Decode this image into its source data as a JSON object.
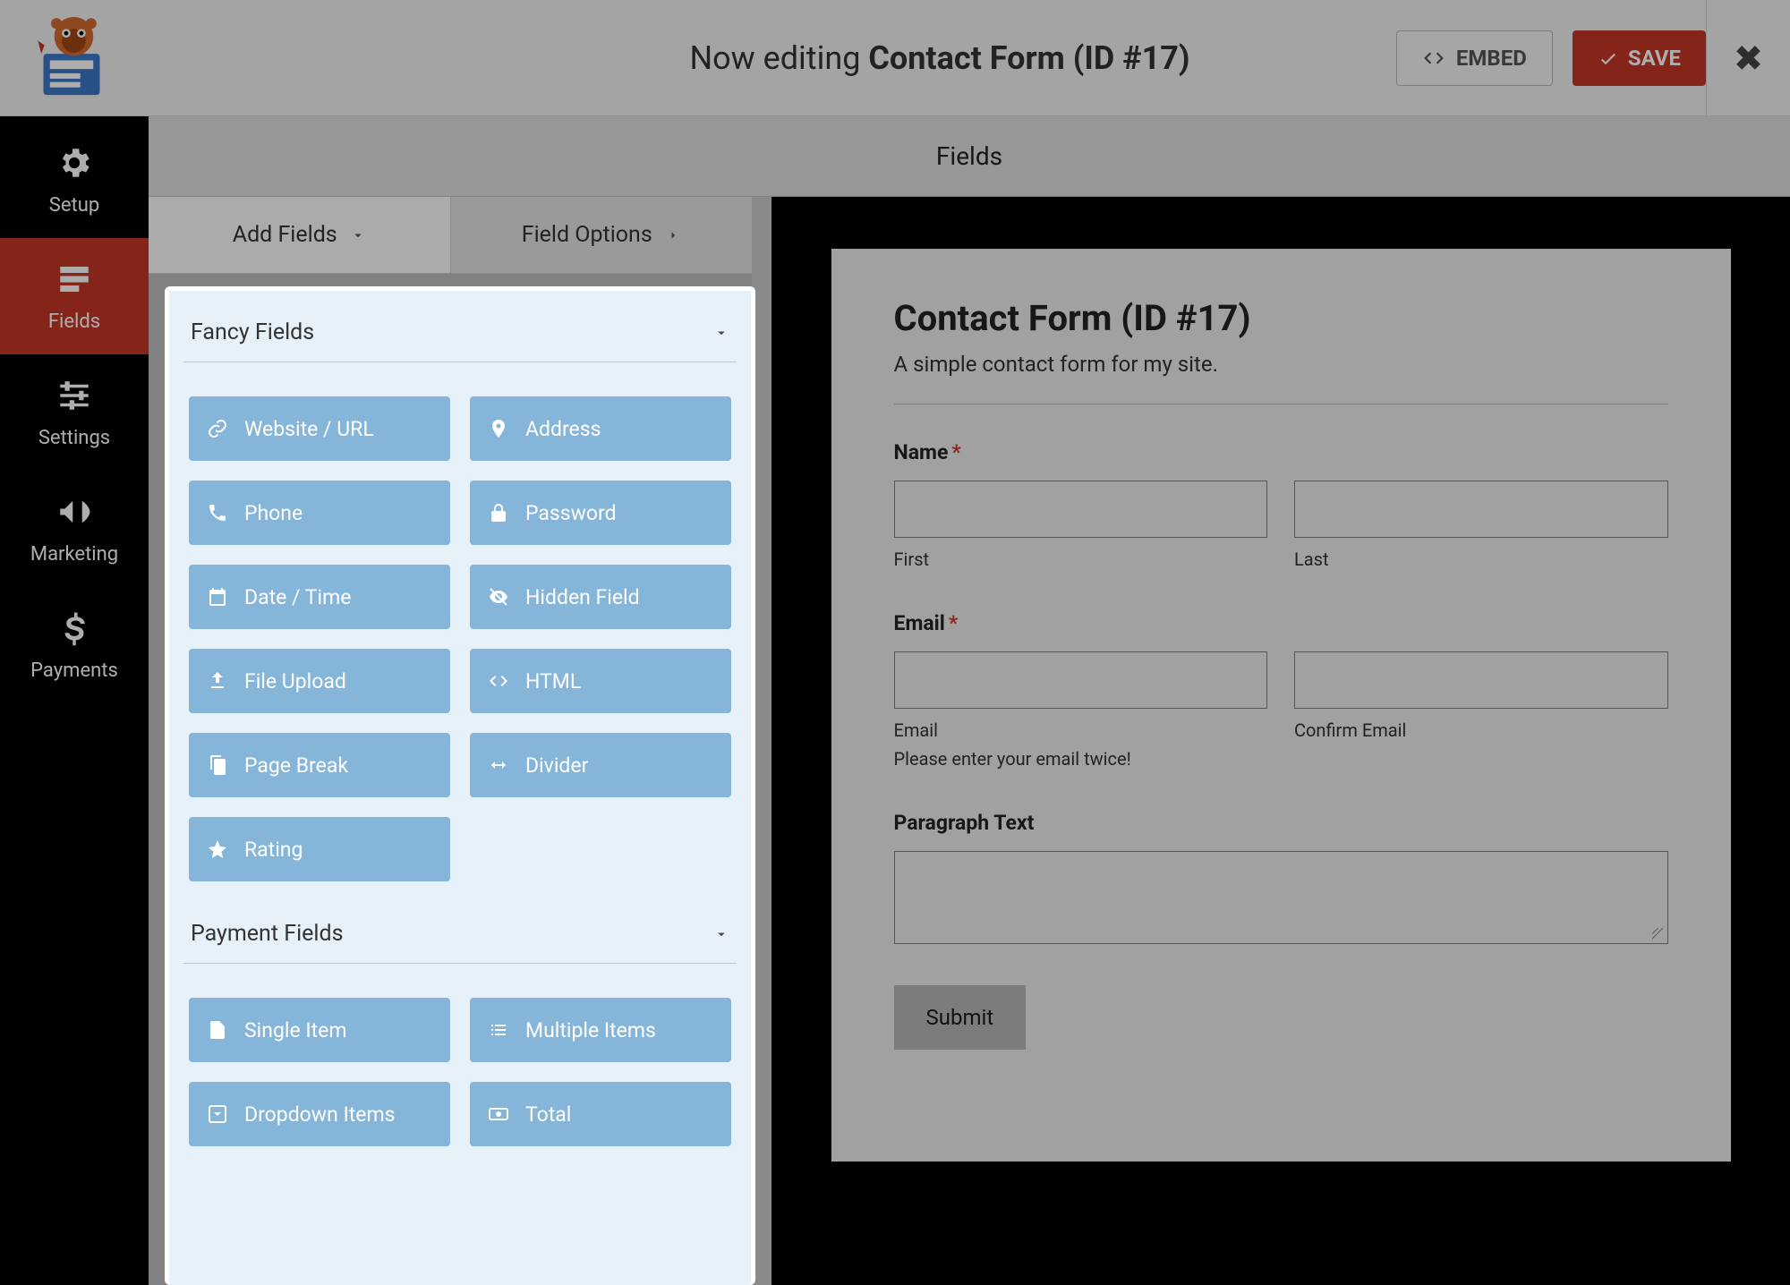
{
  "header": {
    "now_editing_prefix": "Now editing ",
    "form_title": "Contact Form (ID #17)",
    "embed": "EMBED",
    "save": "SAVE"
  },
  "sidebar": {
    "items": [
      {
        "key": "setup",
        "label": "Setup"
      },
      {
        "key": "fields",
        "label": "Fields"
      },
      {
        "key": "settings",
        "label": "Settings"
      },
      {
        "key": "marketing",
        "label": "Marketing"
      },
      {
        "key": "payments",
        "label": "Payments"
      }
    ]
  },
  "subheader": "Fields",
  "tabs": {
    "add": "Add Fields",
    "options": "Field Options"
  },
  "fancy": {
    "title": "Fancy Fields",
    "items": [
      "Website / URL",
      "Address",
      "Phone",
      "Password",
      "Date / Time",
      "Hidden Field",
      "File Upload",
      "HTML",
      "Page Break",
      "Divider",
      "Rating"
    ]
  },
  "payment": {
    "title": "Payment Fields",
    "items": [
      "Single Item",
      "Multiple Items",
      "Dropdown Items",
      "Total"
    ]
  },
  "preview": {
    "title": "Contact Form (ID #17)",
    "desc": "A simple contact form for my site.",
    "name_label": "Name",
    "first": "First",
    "last": "Last",
    "email_label": "Email",
    "email1": "Email",
    "email2": "Confirm Email",
    "email_help": "Please enter your email twice!",
    "paragraph": "Paragraph Text",
    "submit": "Submit"
  }
}
